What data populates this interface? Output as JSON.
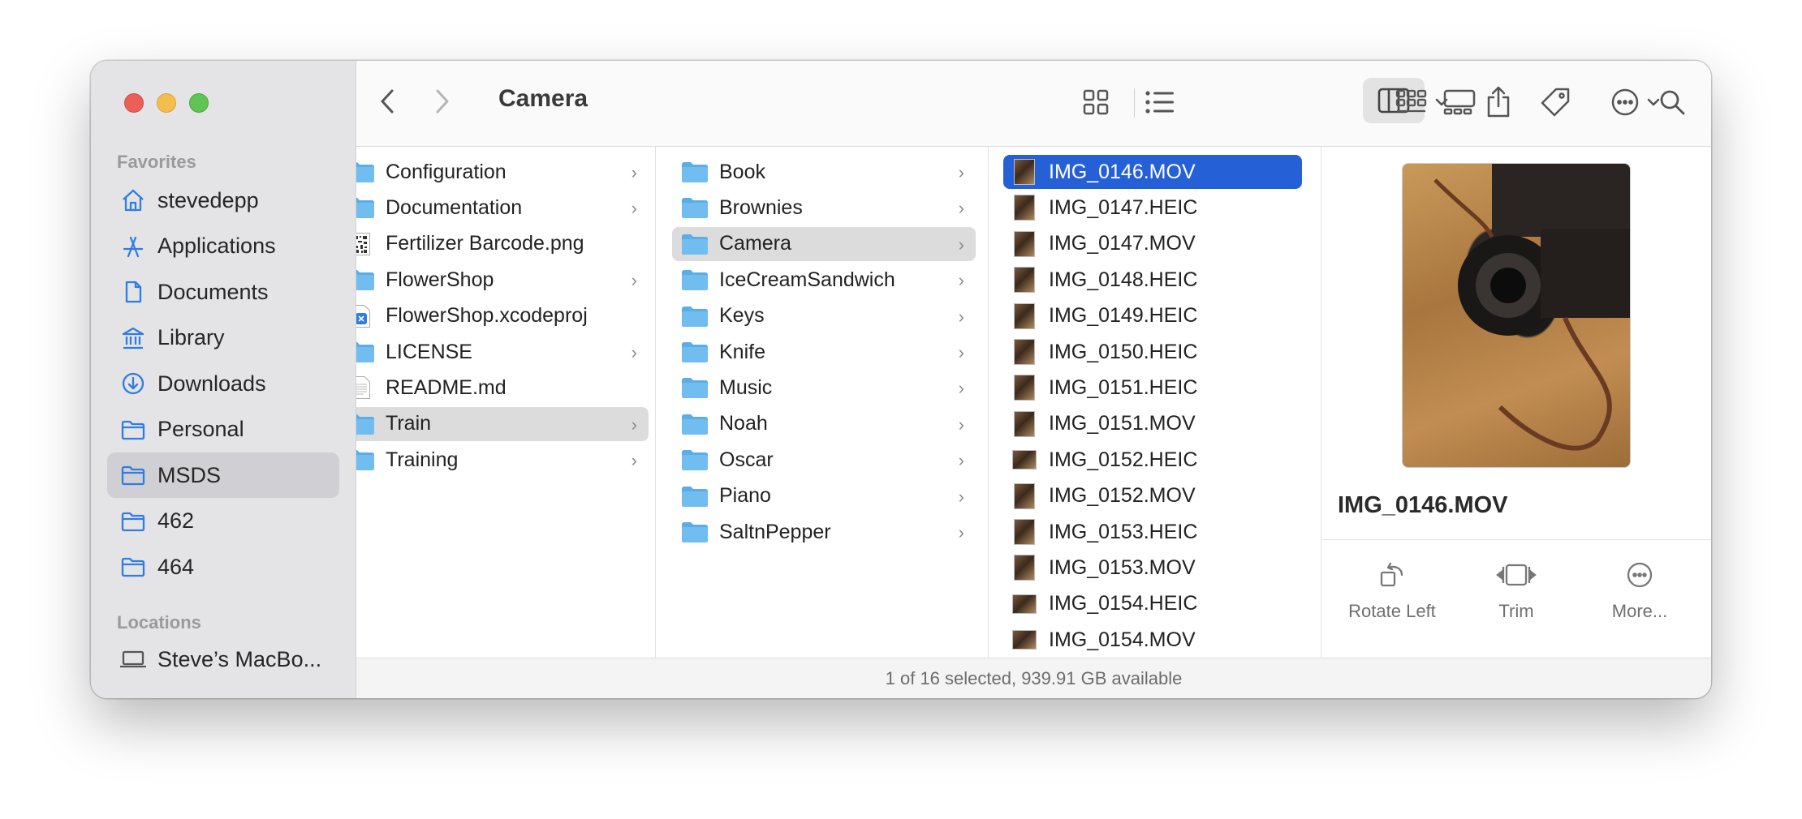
{
  "window": {
    "title": "Camera"
  },
  "sidebar": {
    "favorites_header": "Favorites",
    "favorites": [
      {
        "label": "stevedepp",
        "icon": "home-icon"
      },
      {
        "label": "Applications",
        "icon": "applications-icon"
      },
      {
        "label": "Documents",
        "icon": "document-icon"
      },
      {
        "label": "Library",
        "icon": "library-icon"
      },
      {
        "label": "Downloads",
        "icon": "download-icon"
      },
      {
        "label": "Personal",
        "icon": "folder-icon"
      },
      {
        "label": "MSDS",
        "icon": "folder-icon",
        "selected": true
      },
      {
        "label": "462",
        "icon": "folder-icon"
      },
      {
        "label": "464",
        "icon": "folder-icon"
      }
    ],
    "locations_header": "Locations",
    "locations": [
      {
        "label": "Steve’s MacBo...",
        "icon": "laptop-icon"
      }
    ]
  },
  "toolbar": {
    "back": "back-icon",
    "forward": "forward-icon",
    "views": [
      "icon-view-icon",
      "list-view-icon",
      "column-view-icon",
      "gallery-view-icon"
    ],
    "selected_view": "column-view-icon",
    "group": "group-icon",
    "share": "share-icon",
    "tags": "tag-icon",
    "actions": "more-actions-icon",
    "search": "search-icon"
  },
  "columns": {
    "col1": [
      {
        "label": "Configuration",
        "kind": "folder",
        "chevron": true
      },
      {
        "label": "Documentation",
        "kind": "folder",
        "chevron": true
      },
      {
        "label": "Fertilizer Barcode.png",
        "kind": "barcode"
      },
      {
        "label": "FlowerShop",
        "kind": "folder",
        "chevron": true
      },
      {
        "label": "FlowerShop.xcodeproj",
        "kind": "xcode"
      },
      {
        "label": "LICENSE",
        "kind": "folder",
        "chevron": true
      },
      {
        "label": "README.md",
        "kind": "text"
      },
      {
        "label": "Train",
        "kind": "folder",
        "chevron": true,
        "highlight": true
      },
      {
        "label": "Training",
        "kind": "folder",
        "chevron": true
      }
    ],
    "col2": [
      {
        "label": "Book",
        "kind": "folder",
        "chevron": true
      },
      {
        "label": "Brownies",
        "kind": "folder",
        "chevron": true
      },
      {
        "label": "Camera",
        "kind": "folder",
        "chevron": true,
        "highlight": true
      },
      {
        "label": "IceCreamSandwich",
        "kind": "folder",
        "chevron": true
      },
      {
        "label": "Keys",
        "kind": "folder",
        "chevron": true
      },
      {
        "label": "Knife",
        "kind": "folder",
        "chevron": true
      },
      {
        "label": "Music",
        "kind": "folder",
        "chevron": true
      },
      {
        "label": "Noah",
        "kind": "folder",
        "chevron": true
      },
      {
        "label": "Oscar",
        "kind": "folder",
        "chevron": true
      },
      {
        "label": "Piano",
        "kind": "folder",
        "chevron": true
      },
      {
        "label": "SaltnPepper",
        "kind": "folder",
        "chevron": true
      }
    ],
    "col3": [
      {
        "label": "IMG_0146.MOV",
        "kind": "thumb",
        "selected": true
      },
      {
        "label": "IMG_0147.HEIC",
        "kind": "thumb"
      },
      {
        "label": "IMG_0147.MOV",
        "kind": "thumb"
      },
      {
        "label": "IMG_0148.HEIC",
        "kind": "thumb"
      },
      {
        "label": "IMG_0149.HEIC",
        "kind": "thumb"
      },
      {
        "label": "IMG_0150.HEIC",
        "kind": "thumb"
      },
      {
        "label": "IMG_0151.HEIC",
        "kind": "thumb"
      },
      {
        "label": "IMG_0151.MOV",
        "kind": "thumb"
      },
      {
        "label": "IMG_0152.HEIC",
        "kind": "thumb-wide"
      },
      {
        "label": "IMG_0152.MOV",
        "kind": "thumb"
      },
      {
        "label": "IMG_0153.HEIC",
        "kind": "thumb"
      },
      {
        "label": "IMG_0153.MOV",
        "kind": "thumb"
      },
      {
        "label": "IMG_0154.HEIC",
        "kind": "thumb-wide"
      },
      {
        "label": "IMG_0154.MOV",
        "kind": "thumb-wide"
      }
    ]
  },
  "preview": {
    "filename": "IMG_0146.MOV",
    "actions": [
      {
        "label": "Rotate Left",
        "icon": "rotate-left-icon"
      },
      {
        "label": "Trim",
        "icon": "trim-icon"
      },
      {
        "label": "More...",
        "icon": "ellipsis-circle-icon"
      }
    ]
  },
  "status": {
    "text": "1 of 16 selected, 939.91 GB available"
  },
  "colors": {
    "selection": "#2660d6",
    "folder": "#5aaee8",
    "close": "#ec5f59",
    "minimize": "#f4be4f",
    "zoom": "#5fc454"
  }
}
